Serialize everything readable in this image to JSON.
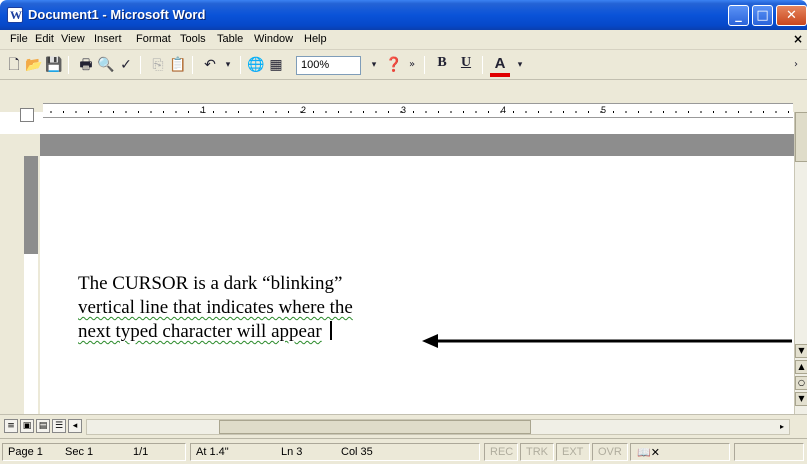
{
  "window": {
    "title": "Document1 - Microsoft Word"
  },
  "menu": [
    "File",
    "Edit",
    "View",
    "Insert",
    "Format",
    "Tools",
    "Table",
    "Window",
    "Help"
  ],
  "toolbar": {
    "zoom_value": "100%"
  },
  "ruler": {
    "numbers": [
      "1",
      "2",
      "3",
      "4",
      "5"
    ]
  },
  "document": {
    "lines": [
      "The CURSOR is a dark “blinking”",
      "vertical line that indicates where the",
      "next typed character will appear"
    ]
  },
  "status": {
    "page": "Page 1",
    "sec": "Sec 1",
    "pages": "1/1",
    "at": "At 1.4\"",
    "ln": "Ln 3",
    "col": "Col 35",
    "rec": "REC",
    "trk": "TRK",
    "ext": "EXT",
    "ovr": "OVR"
  },
  "icons": [
    "new-icon",
    "open-icon",
    "save-icon",
    "print-icon",
    "preview-icon",
    "spelling-icon",
    "copy-icon",
    "paste-icon",
    "undo-icon",
    "hyperlink-icon",
    "table-icon",
    "help-icon",
    "bold-icon",
    "underline-icon",
    "font-color-icon"
  ]
}
